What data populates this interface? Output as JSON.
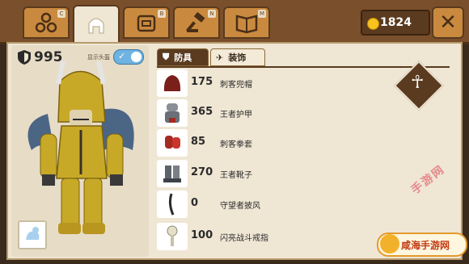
{
  "header": {
    "tabs": [
      {
        "name": "skills-tab",
        "key": "C",
        "icon": "nodes-icon"
      },
      {
        "name": "equipment-tab",
        "key": "",
        "icon": "helmet-icon"
      },
      {
        "name": "bag-tab",
        "key": "B",
        "icon": "backpack-icon"
      },
      {
        "name": "craft-tab",
        "key": "N",
        "icon": "hammer-icon"
      },
      {
        "name": "book-tab",
        "key": "M",
        "icon": "book-icon"
      }
    ],
    "coins": "1824",
    "close_label": "✕"
  },
  "character": {
    "defense": "995",
    "show_helmet_label": "显示头盔",
    "show_helmet_on": true
  },
  "tabs": {
    "armor": "防具",
    "decoration": "装饰"
  },
  "items": [
    {
      "value": "175",
      "name": "刺客兜帽",
      "icon": "hood-icon",
      "color": "#7a1f1a"
    },
    {
      "value": "365",
      "name": "王者护甲",
      "icon": "armor-icon",
      "color": "#6b6f78"
    },
    {
      "value": "85",
      "name": "刺客拳套",
      "icon": "gauntlet-icon",
      "color": "#a52a22"
    },
    {
      "value": "270",
      "name": "王者靴子",
      "icon": "boots-icon",
      "color": "#5e626b"
    },
    {
      "value": "0",
      "name": "守望者披风",
      "icon": "cape-icon",
      "color": "#2a2a2a"
    },
    {
      "value": "100",
      "name": "闪亮战斗戒指",
      "icon": "ring-icon",
      "color": "#d8d2b8"
    }
  ],
  "watermark": {
    "text": "咸海手游网",
    "stamp": "手游网"
  }
}
